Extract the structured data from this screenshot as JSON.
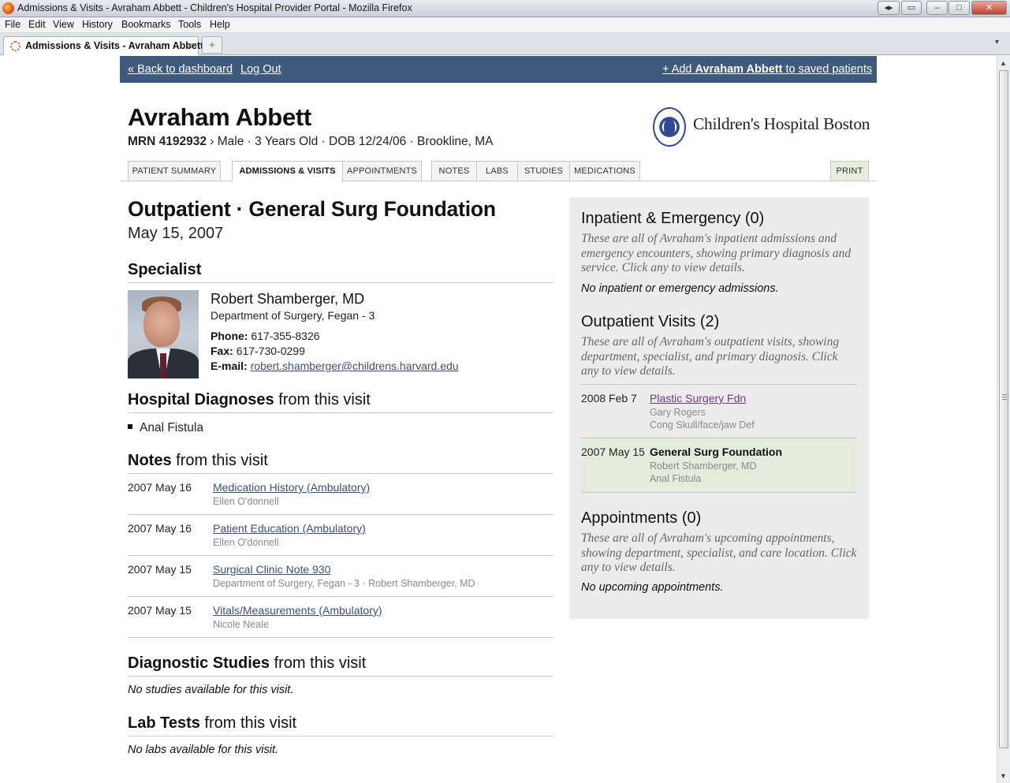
{
  "browser": {
    "window_title": "Admissions & Visits - Avraham Abbett - Children's Hospital Provider Portal - Mozilla Firefox",
    "menu": [
      "File",
      "Edit",
      "View",
      "History",
      "Bookmarks",
      "Tools",
      "Help"
    ],
    "tab_title": "Admissions & Visits - Avraham Abbett...",
    "new_tab_glyph": "+",
    "tab_close_glyph": "×"
  },
  "topbar": {
    "back_label": "« Back to dashboard",
    "logout_label": "Log Out",
    "add_prefix": "+ Add ",
    "add_name": "Avraham Abbett",
    "add_suffix": " to saved patients"
  },
  "patient": {
    "name": "Avraham Abbett",
    "mrn": "MRN 4192932",
    "details": " ›  Male · 3 Years Old · DOB 12/24/06 · Brookline, MA"
  },
  "hospital": {
    "name": "Children's Hospital Boston"
  },
  "nav": {
    "tabs": [
      "Patient Summary",
      "Admissions & Visits",
      "Appointments",
      "Notes",
      "Labs",
      "Studies",
      "Medications"
    ],
    "active": "Admissions & Visits",
    "print": "Print"
  },
  "visit": {
    "title": "Outpatient · General Surg Foundation",
    "date": "May 15, 2007"
  },
  "specialist": {
    "heading": "Specialist",
    "name": "Robert Shamberger, MD",
    "department": "Department of Surgery, Fegan - 3",
    "phone_label": "Phone:",
    "phone": "617-355-8326",
    "fax_label": "Fax:",
    "fax": "617-730-0299",
    "email_label": "E-mail:",
    "email": "robert.shamberger@childrens.harvard.edu"
  },
  "diagnoses": {
    "heading_bold": "Hospital Diagnoses",
    "heading_rest": " from this visit",
    "items": [
      "Anal Fistula"
    ]
  },
  "notes": {
    "heading_bold": "Notes",
    "heading_rest": " from this visit",
    "rows": [
      {
        "date": "2007 May 16",
        "title": "Medication History (Ambulatory)",
        "author": "Ellen O'donnell"
      },
      {
        "date": "2007 May 16",
        "title": "Patient Education (Ambulatory)",
        "author": "Ellen O'donnell"
      },
      {
        "date": "2007 May 15",
        "title": "Surgical Clinic Note 930",
        "author": "Department of Surgery, Fegan - 3 · Robert Shamberger, MD"
      },
      {
        "date": "2007 May 15",
        "title": "Vitals/Measurements (Ambulatory)",
        "author": "Nicole Neale"
      }
    ]
  },
  "studies": {
    "heading_bold": "Diagnostic Studies",
    "heading_rest": " from this visit",
    "empty": "No studies available for this visit."
  },
  "labs": {
    "heading_bold": "Lab Tests",
    "heading_rest": " from this visit",
    "empty": "No labs available for this visit."
  },
  "sidebar": {
    "inpatient": {
      "heading": "Inpatient & Emergency (0)",
      "description": "These are all of Avraham's inpatient admissions and emergency encounters, showing primary diagnosis and service. Click any to view details.",
      "empty": "No inpatient or emergency admissions."
    },
    "outpatient": {
      "heading": "Outpatient Visits (2)",
      "description": "These are all of Avraham's outpatient visits, showing department, specialist, and primary diagnosis. Click any to view details.",
      "visits": [
        {
          "date": "2008 Feb 7",
          "department": "Plastic Surgery Fdn",
          "specialist": "Gary Rogers",
          "diagnosis": "Cong Skull/face/jaw Def"
        },
        {
          "date": "2007 May 15",
          "department": "General Surg Foundation",
          "specialist": "Robert Shamberger, MD",
          "diagnosis": "Anal Fistula"
        }
      ]
    },
    "appointments": {
      "heading": "Appointments (0)",
      "description": "These are all of Avraham's upcoming appointments, showing department, specialist, and care location. Click any to view details.",
      "empty": "No upcoming appointments."
    }
  },
  "colors": {
    "topbar": "#3f5a7c",
    "sidebar_bg": "#ececec",
    "active_visit_bg": "#e5ecdc",
    "link": "#3d4f76"
  }
}
